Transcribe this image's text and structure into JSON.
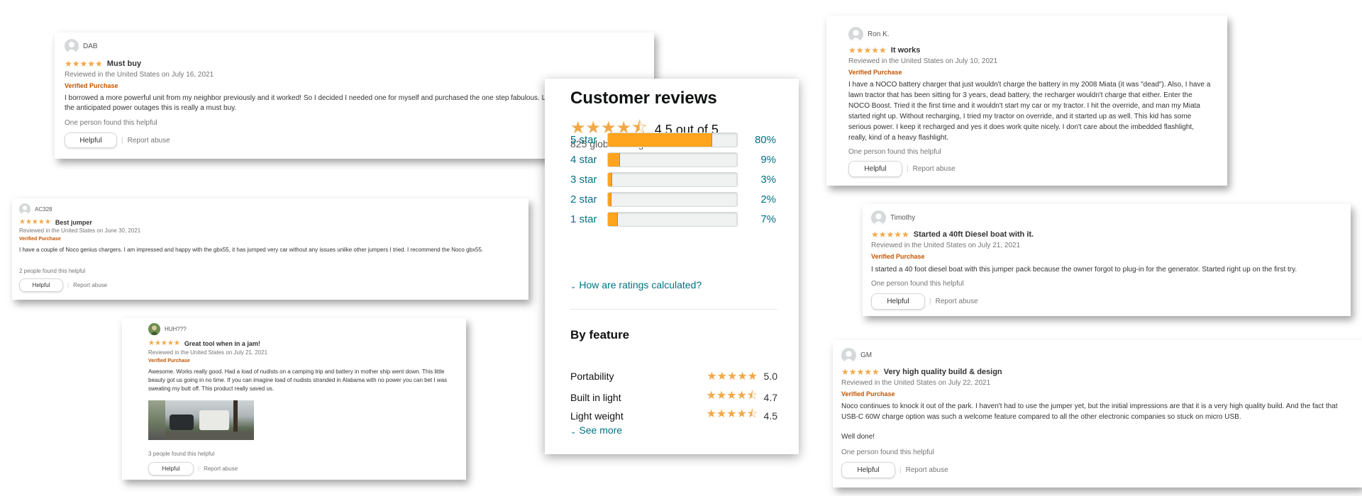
{
  "summary": {
    "title": "Customer reviews",
    "average_stars": "★★★★⯪",
    "average_text": "4.5 out of 5",
    "global_ratings": "825 global ratings",
    "histogram": [
      {
        "label": "5 star",
        "percent": 80,
        "percent_text": "80%"
      },
      {
        "label": "4 star",
        "percent": 9,
        "percent_text": "9%"
      },
      {
        "label": "3 star",
        "percent": 3,
        "percent_text": "3%"
      },
      {
        "label": "2 star",
        "percent": 2,
        "percent_text": "2%"
      },
      {
        "label": "1 star",
        "percent": 7,
        "percent_text": "7%"
      }
    ],
    "how_calculated": "How are ratings calculated?",
    "by_feature_title": "By feature",
    "features": [
      {
        "name": "Portability",
        "stars": "★★★★★",
        "value": "5.0"
      },
      {
        "name": "Built in light",
        "stars": "★★★★⯪",
        "value": "4.7"
      },
      {
        "name": "Light weight",
        "stars": "★★★★⯪",
        "value": "4.5"
      }
    ],
    "see_more": "See more"
  },
  "reviews": [
    {
      "user": "DAB",
      "stars": "★★★★★",
      "title": "Must buy",
      "meta": "Reviewed in the United States on July 16, 2021",
      "verified": "Verified Purchase",
      "body": "I borrowed a more powerful unit from my neighbor previously and it worked! So I decided I needed one for myself and purchased the one step fabulous. Living in Northern California with the anticipated power outages this is really a must buy.",
      "helpful_count": "One person found this helpful"
    },
    {
      "user": "AC328",
      "stars": "★★★★★",
      "title": "Best jumper",
      "meta": "Reviewed in the United States on June 30, 2021",
      "verified": "Verified Purchase",
      "body": "I have a couple of Noco genius chargers. I am impressed and happy with the gbx55, it has jumped very car without any issues unlike other jumpers I tried. I recommend the Noco gbx55.",
      "helpful_count": "2 people found this helpful"
    },
    {
      "user": "HUH???",
      "stars": "★★★★★",
      "title": "Great tool when in a jam!",
      "meta": "Reviewed in the United States on July 21, 2021",
      "verified": "Verified Purchase",
      "body": "Awesome. Works really good. Had a load of nudists on a camping trip and battery in mother ship went down. This little beauty got us going in no time. If you can imagine load of nudists stranded in Alabama with no power you can bet I was sweating my butt off. This product really saved us.",
      "helpful_count": "3 people found this helpful"
    },
    {
      "user": "Ron K.",
      "stars": "★★★★★",
      "title": "It works",
      "meta": "Reviewed in the United States on July 10, 2021",
      "verified": "Verified Purchase",
      "body": "I have a NOCO battery charger that just wouldn't charge the battery in my 2008 Miata (it was \"dead\"). Also, I have a lawn tractor that has been sitting for 3 years, dead battery, the recharger wouldn't charge that either. Enter the NOCO Boost. Tried it the first time and it wouldn't start my car or my tractor. I hit the override, and man my Miata started right up. Without recharging, I tried my tractor on override, and it started up as well. This kid has some serious power. I keep it recharged and yes it does work quite nicely. I don't care about the imbedded flashlight, really, kind of a heavy flashlight.",
      "helpful_count": "One person found this helpful"
    },
    {
      "user": "Timothy",
      "stars": "★★★★★",
      "title": "Started a 40ft Diesel boat with it.",
      "meta": "Reviewed in the United States on July 21, 2021",
      "verified": "Verified Purchase",
      "body": "I started a 40 foot diesel boat with this jumper pack because the owner forgot to plug-in for the generator. Started right up on the first try.",
      "helpful_count": "One person found this helpful"
    },
    {
      "user": "GM",
      "stars": "★★★★★",
      "title": "Very high quality build & design",
      "meta": "Reviewed in the United States on July 22, 2021",
      "verified": "Verified Purchase",
      "body": "Noco continues to knock it out of the park. I haven't had to use the jumper yet, but the initial impressions are that it is a very high quality build. And the fact that USB-C 60W charge option was such a welcome feature compared to all the other electronic companies so stuck on micro USB.",
      "body2": "Well done!",
      "helpful_count": "One person found this helpful"
    }
  ],
  "helpful_label": "Helpful",
  "report_label": "Report abuse",
  "colors": {
    "star": "#f3a847",
    "bar_fill": "#ffa41c",
    "link": "#007185",
    "verified": "#c45500"
  }
}
